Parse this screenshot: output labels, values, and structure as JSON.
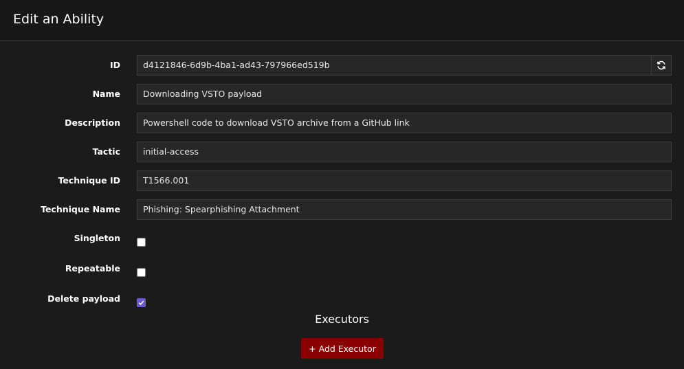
{
  "header": {
    "title": "Edit an Ability"
  },
  "form": {
    "id": {
      "label": "ID",
      "value": "d4121846-6d9b-4ba1-ad43-797966ed519b"
    },
    "name": {
      "label": "Name",
      "value": "Downloading VSTO payload"
    },
    "description": {
      "label": "Description",
      "value": "Powershell code to download VSTO archive from a GitHub link"
    },
    "tactic": {
      "label": "Tactic",
      "value": "initial-access"
    },
    "technique_id": {
      "label": "Technique ID",
      "value": "T1566.001"
    },
    "technique_name": {
      "label": "Technique Name",
      "value": "Phishing: Spearphishing Attachment"
    },
    "singleton": {
      "label": "Singleton",
      "checked": false
    },
    "repeatable": {
      "label": "Repeatable",
      "checked": false
    },
    "delete_payload": {
      "label": "Delete payload",
      "checked": true
    }
  },
  "executors": {
    "title": "Executors",
    "add_button": "+ Add Executor"
  },
  "icons": {
    "refresh": "refresh-icon",
    "check": "check-icon"
  },
  "colors": {
    "accent": "#8b0000",
    "checkbox_checked": "#6a5acd"
  }
}
